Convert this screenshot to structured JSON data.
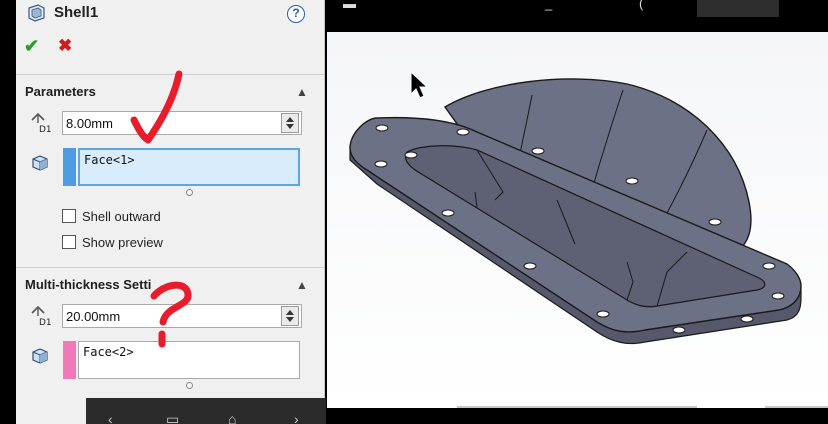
{
  "feature": {
    "title": "Shell1",
    "help_label": "?",
    "ok_glyph": "✔",
    "cancel_glyph": "✖"
  },
  "parameters": {
    "header": "Parameters",
    "collapse_glyph": "▲",
    "thickness_value": "8.00mm",
    "faces_value": "Face<1>",
    "faces_color": "#4d9de0",
    "shell_outward_label": "Shell outward",
    "shell_outward_checked": false,
    "show_preview_label": "Show preview",
    "show_preview_checked": false
  },
  "multi_thickness": {
    "header": "Multi-thickness Setti",
    "collapse_glyph": "▲",
    "thickness_value": "20.00mm",
    "faces_value": "Face<2>",
    "faces_color": "#f07ab7"
  },
  "icons": {
    "dim_label": "D1"
  },
  "colors": {
    "annotation": "#e81c2a",
    "part_body": "#6d7185",
    "part_edge": "#1a1a1a"
  }
}
